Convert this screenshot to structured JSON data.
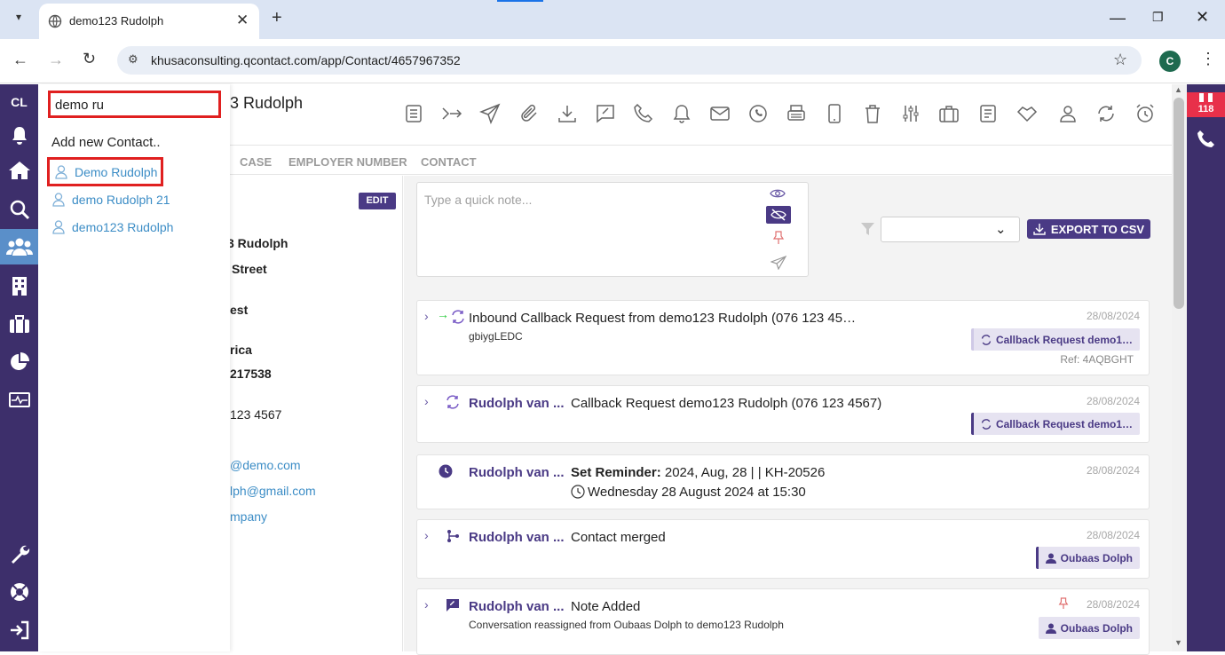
{
  "browser": {
    "tab_title": "demo123 Rudolph",
    "url": "khusaconsulting.qcontact.com/app/Contact/4657967352",
    "profile_initial": "C"
  },
  "leftnav": {
    "logo": "CL"
  },
  "rightrail": {
    "badge": "118"
  },
  "search": {
    "query": "demo ru",
    "add_new": "Add new Contact..",
    "suggestions": [
      "Demo Rudolph",
      "demo Rudolph 21",
      "demo123 Rudolph"
    ]
  },
  "contact": {
    "name_partial": "3 Rudolph",
    "edit_label": "EDIT",
    "details": {
      "name": "3 Rudolph",
      "street": "Street",
      "suburb": "est",
      "country": "rica",
      "id": "217538",
      "phone": "123 4567",
      "email1": "@demo.com",
      "email2": "lph@gmail.com",
      "company": "mpany"
    }
  },
  "subtabs": [
    "CASE",
    "EMPLOYER NUMBER",
    "CONTACT"
  ],
  "note": {
    "placeholder": "Type a quick note..."
  },
  "export_label": "EXPORT TO CSV",
  "feed": [
    {
      "title": "Inbound Callback Request from demo123 Rudolph (076 123 45…",
      "sub": "gbiygLEDC",
      "date": "28/08/2024",
      "tag": "Callback Request demo1…",
      "ref": "Ref: 4AQBGHT"
    },
    {
      "who": "Rudolph van ...",
      "text": "Callback Request demo123 Rudolph (076 123 4567)",
      "date": "28/08/2024",
      "tag": "Callback Request demo1…"
    },
    {
      "who": "Rudolph van ...",
      "text_bold": "Set Reminder:",
      "text": " 2024, Aug, 28 | | KH-20526",
      "line2": "Wednesday 28 August 2024 at 15:30",
      "date": "28/08/2024"
    },
    {
      "who": "Rudolph van ...",
      "text": "Contact merged",
      "date": "28/08/2024",
      "tag": "Oubaas Dolph"
    },
    {
      "who": "Rudolph van ...",
      "text": "Note Added",
      "sub": "Conversation reassigned from Oubaas Dolph to demo123 Rudolph",
      "date": "28/08/2024",
      "tag": "Oubaas Dolph"
    }
  ],
  "colors": {
    "accent": "#4a3a85",
    "nav": "#3d2f6b",
    "link": "#3c8dc6",
    "highlight": "#e02020",
    "badge": "#e8304a"
  }
}
